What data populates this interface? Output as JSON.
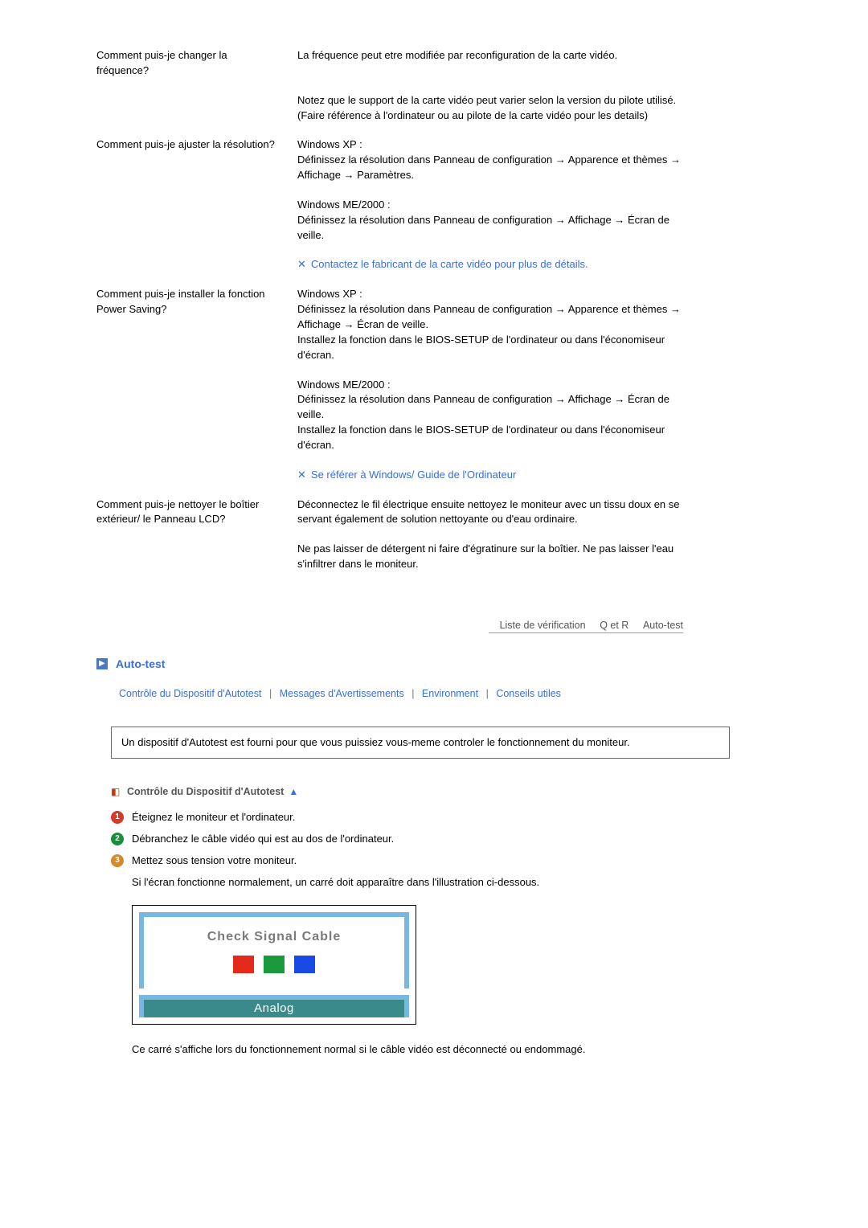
{
  "qa": [
    {
      "q": "Comment puis-je changer la fréquence?",
      "answers": [
        "La fréquence peut etre modifiée par reconfiguration de la carte vidéo.",
        "Notez que le support de la carte vidéo peut varier selon la version du pilote utilisé.\n(Faire référence à l'ordinateur ou au pilote de la carte vidéo pour les details)"
      ]
    },
    {
      "q": "Comment puis-je ajuster la résolution?",
      "answers": [
        "Windows XP :\nDéfinissez la résolution dans Panneau de configuration → Apparence et thèmes → Affichage → Paramètres.",
        "Windows ME/2000 :\nDéfinissez la résolution dans Panneau de configuration → Affichage → Écran de veille."
      ],
      "note": "Contactez le fabricant de la carte vidéo pour plus de détails."
    },
    {
      "q": "Comment puis-je installer la fonction Power Saving?",
      "answers": [
        "Windows XP :\nDéfinissez la résolution dans Panneau de configuration → Apparence et thèmes → Affichage → Écran de veille.\nInstallez la fonction dans le BIOS-SETUP de l'ordinateur ou dans l'économiseur d'écran.",
        "Windows ME/2000 :\nDéfinissez la résolution dans Panneau de configuration → Affichage → Écran de veille.\nInstallez la fonction dans le BIOS-SETUP de l'ordinateur ou dans l'économiseur d'écran."
      ],
      "note": "Se référer à Windows/ Guide de l'Ordinateur"
    },
    {
      "q": "Comment puis-je nettoyer le boîtier extérieur/ le Panneau LCD?",
      "answers": [
        "Déconnectez le fil électrique ensuite nettoyez le moniteur avec un tissu doux en se servant également de solution nettoyante ou d'eau ordinaire.",
        "Ne pas laisser de détergent ni faire d'égratinure sur la boîtier. Ne pas laisser l'eau s'infiltrer dans le moniteur."
      ]
    }
  ],
  "tabs": [
    "Liste de vérification",
    "Q et R",
    "Auto-test"
  ],
  "section_title": "Auto-test",
  "sublinks": [
    "Contrôle du Dispositif d'Autotest",
    "Messages d'Avertissements",
    "Environment",
    "Conseils utiles"
  ],
  "infobox": "Un dispositif d'Autotest est fourni pour que vous puissiez vous-meme controler le fonctionnement du moniteur.",
  "subheading": "Contrôle du Dispositif d'Autotest",
  "steps": [
    "Éteignez le moniteur et l'ordinateur.",
    "Débranchez le câble vidéo qui est au dos de l'ordinateur.",
    "Mettez sous tension votre moniteur."
  ],
  "step_extra": "Si l'écran fonctionne normalement, un carré doit apparaître dans l'illustration ci-dessous.",
  "illustration": {
    "title": "Check Signal Cable",
    "bar": "Analog"
  },
  "caption": "Ce carré s'affiche lors du fonctionnement normal si le câble vidéo est déconnecté ou endommagé."
}
